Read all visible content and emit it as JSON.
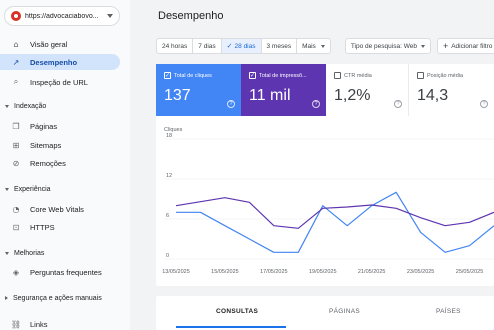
{
  "property": {
    "url": "https://advocaciabovo..."
  },
  "sidebar": {
    "items_top": [
      {
        "label": "Visão geral",
        "icon": "home-icon"
      },
      {
        "label": "Desempenho",
        "icon": "trending-up-icon"
      },
      {
        "label": "Inspeção de URL",
        "icon": "search-icon"
      }
    ],
    "sections": {
      "indexacao": "Indexação",
      "experiencia": "Experiência",
      "melhorias": "Melhorias",
      "seguranca": "Segurança e ações manuais"
    },
    "indexacao_items": [
      {
        "label": "Páginas",
        "icon": "file-copy-icon"
      },
      {
        "label": "Sitemaps",
        "icon": "sitemap-icon"
      },
      {
        "label": "Remoções",
        "icon": "visibility-off-icon"
      }
    ],
    "experiencia_items": [
      {
        "label": "Core Web Vitals",
        "icon": "speed-icon"
      },
      {
        "label": "HTTPS",
        "icon": "lock-icon"
      }
    ],
    "melhorias_items": [
      {
        "label": "Perguntas frequentes",
        "icon": "layers-icon"
      }
    ],
    "links": {
      "label": "Links",
      "icon": "links-icon"
    }
  },
  "main": {
    "title": "Desempenho",
    "date_ranges": [
      "24 horas",
      "7 dias",
      "28 dias",
      "3 meses",
      "Mais"
    ],
    "selected_range": "28 dias",
    "search_type": "Tipo de pesquisa: Web",
    "add_filter": "Adicionar filtro"
  },
  "metrics": {
    "clicks": {
      "label": "Total de cliques",
      "value": "137"
    },
    "impressions": {
      "label": "Total de impressõ...",
      "value": "11 mil"
    },
    "ctr": {
      "label": "CTR média",
      "value": "1,2%"
    },
    "position": {
      "label": "Posição média",
      "value": "14,3"
    }
  },
  "colors": {
    "clicks": "#4285f4",
    "impressions": "#5e35b1",
    "active_nav": "#d2e3fc"
  },
  "chart_data": {
    "type": "line",
    "ylabel": "Cliques",
    "ylim": [
      0,
      18
    ],
    "yticks": [
      "18",
      "12",
      "6",
      "0"
    ],
    "x_ticks": [
      "13/05/2025",
      "15/05/2025",
      "17/05/2025",
      "19/05/2025",
      "21/05/2025",
      "23/05/2025",
      "25/05/2025"
    ],
    "x": [
      "13/05/2025",
      "14/05/2025",
      "15/05/2025",
      "16/05/2025",
      "17/05/2025",
      "18/05/2025",
      "19/05/2025",
      "20/05/2025",
      "21/05/2025",
      "22/05/2025",
      "23/05/2025",
      "24/05/2025",
      "25/05/2025",
      "26/05/2025"
    ],
    "series": [
      {
        "name": "Total de cliques",
        "color": "#4285f4",
        "values": [
          7,
          7,
          5,
          3,
          1,
          1,
          8,
          5,
          8,
          10,
          4,
          1,
          2,
          5
        ]
      },
      {
        "name": "Total de impressões",
        "color": "#5e35b1",
        "values": [
          8,
          8.6,
          9.2,
          8.5,
          5,
          4.6,
          7.6,
          7.8,
          8.1,
          7.6,
          6.2,
          5,
          5.5,
          7
        ]
      }
    ]
  },
  "tabs": [
    "CONSULTAS",
    "PÁGINAS",
    "PAÍSES"
  ],
  "active_tab": "CONSULTAS"
}
